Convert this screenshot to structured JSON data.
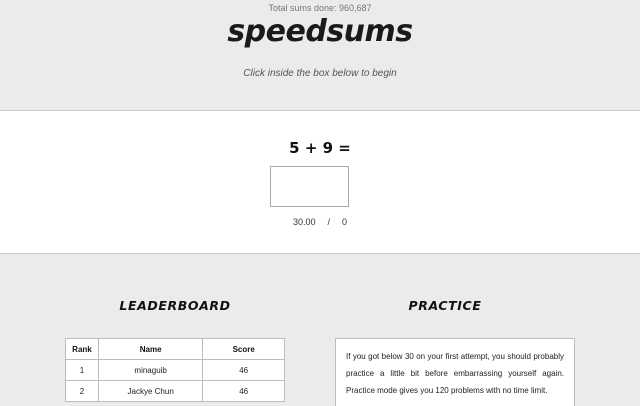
{
  "header": {
    "total_sums": "Total sums done: 960,687",
    "logo": "speedsums",
    "instruction": "Click inside the box below to begin"
  },
  "game": {
    "problem": "5 + 9 =",
    "answer_value": "",
    "timer": "30.00",
    "separator": "/",
    "score": "0"
  },
  "leaderboard": {
    "title": "LEADERBOARD",
    "columns": [
      "Rank",
      "Name",
      "Score"
    ],
    "rows": [
      {
        "rank": "1",
        "name": "minaguib",
        "score": "46"
      },
      {
        "rank": "2",
        "name": "Jackye Chun",
        "score": "46"
      }
    ]
  },
  "practice": {
    "title": "PRACTICE",
    "text": "If you got below 30 on your first attempt, you should probably practice a little bit before embarrassing yourself again. Practice mode gives you 120 problems with no time limit."
  }
}
